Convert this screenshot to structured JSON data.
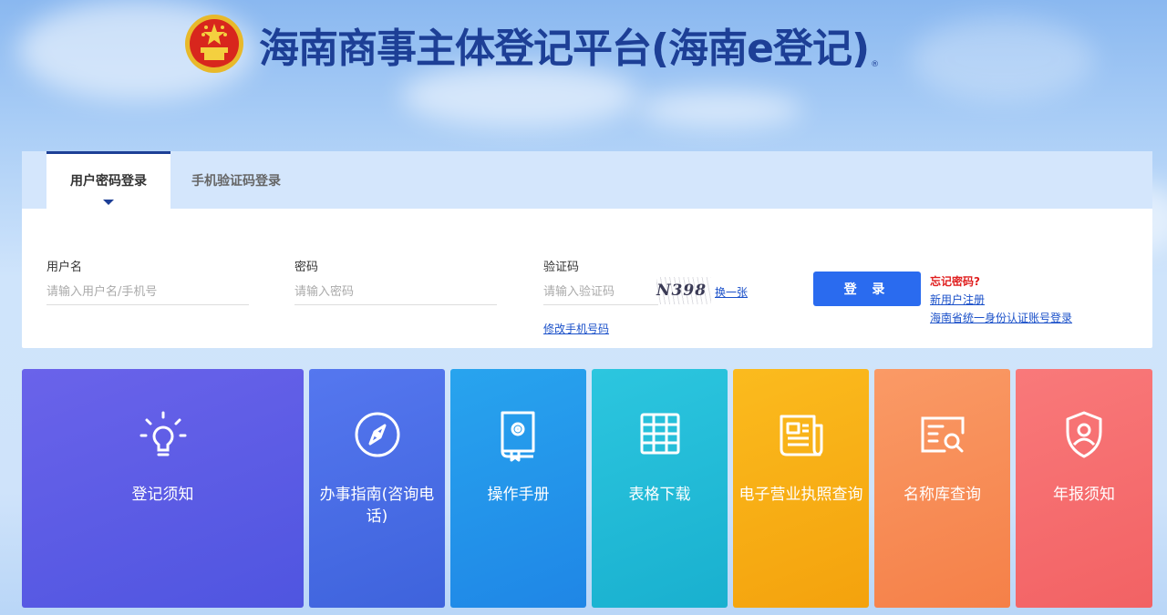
{
  "header": {
    "title": "海南商事主体登记平台(海南e登记)",
    "title_mark": "®",
    "emblem_icon": "national-emblem-icon"
  },
  "login": {
    "tabs": [
      {
        "label": "用户密码登录",
        "active": true
      },
      {
        "label": "手机验证码登录",
        "active": false
      }
    ],
    "username": {
      "label": "用户名",
      "placeholder": "请输入用户名/手机号",
      "value": ""
    },
    "password": {
      "label": "密码",
      "placeholder": "请输入密码",
      "value": ""
    },
    "captcha": {
      "label": "验证码",
      "placeholder": "请输入验证码",
      "value": "",
      "image_text": "N398",
      "refresh_label": "换一张",
      "modify_phone_label": "修改手机号码"
    },
    "submit_label": "登 录",
    "forgot_label": "忘记密码?",
    "register_label": "新用户注册",
    "unified_login_label": "海南省统一身份认证账号登录"
  },
  "colors": {
    "brand": "#1d3f96",
    "button": "#2a6bef",
    "forgot": "#e02020",
    "link": "#1a50c9"
  },
  "tiles": [
    {
      "label": "登记须知",
      "icon": "lightbulb-icon",
      "gradient": [
        "#6a63ea",
        "#4f55e0"
      ]
    },
    {
      "label": "办事指南(咨询电话)",
      "icon": "compass-icon",
      "gradient": [
        "#5577ef",
        "#3e63dc"
      ]
    },
    {
      "label": "操作手册",
      "icon": "manual-book-icon",
      "gradient": [
        "#28a4ee",
        "#1f86e6"
      ]
    },
    {
      "label": "表格下载",
      "icon": "table-grid-icon",
      "gradient": [
        "#2cc6df",
        "#19b0cf"
      ]
    },
    {
      "label": "电子营业执照查询",
      "icon": "newspaper-icon",
      "gradient": [
        "#fbbb1e",
        "#f4a20d"
      ]
    },
    {
      "label": "名称库查询",
      "icon": "search-card-icon",
      "gradient": [
        "#fa9a66",
        "#f58048"
      ]
    },
    {
      "label": "年报须知",
      "icon": "user-shield-icon",
      "gradient": [
        "#f9797a",
        "#f26264"
      ]
    }
  ]
}
